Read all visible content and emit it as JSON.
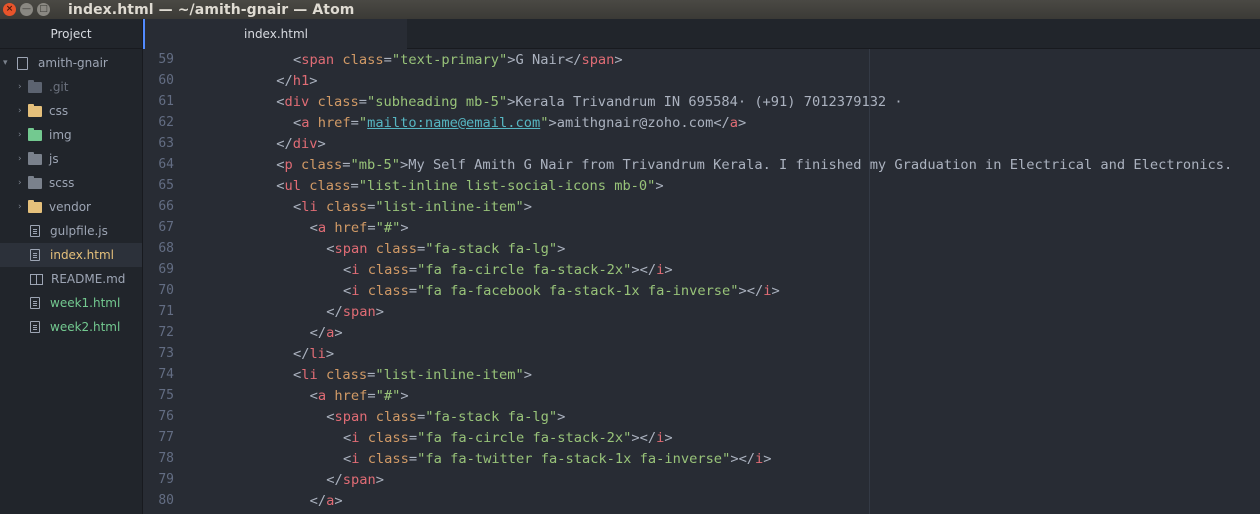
{
  "window": {
    "title": "index.html — ~/amith-gnair — Atom",
    "close_glyph": "×",
    "minimize_glyph": "—",
    "maximize_glyph": "□"
  },
  "sidebar": {
    "header": "Project",
    "root": {
      "name": "amith-gnair",
      "icon": "repo-icon"
    },
    "items": [
      {
        "name": ".git",
        "kind": "folder",
        "icon": "folder-icon",
        "color": "#5c6370"
      },
      {
        "name": "css",
        "kind": "folder",
        "icon": "folder-icon",
        "color": "#e5c07b"
      },
      {
        "name": "img",
        "kind": "folder",
        "icon": "folder-icon",
        "color": "#73c990"
      },
      {
        "name": "js",
        "kind": "folder",
        "icon": "folder-icon",
        "color": "#7a818c"
      },
      {
        "name": "scss",
        "kind": "folder",
        "icon": "folder-icon",
        "color": "#7a818c"
      },
      {
        "name": "vendor",
        "kind": "folder",
        "icon": "folder-icon",
        "color": "#e5c07b"
      },
      {
        "name": "gulpfile.js",
        "kind": "file",
        "icon": "file-icon"
      },
      {
        "name": "index.html",
        "kind": "file",
        "icon": "file-icon",
        "selected": true
      },
      {
        "name": "README.md",
        "kind": "file",
        "icon": "book-icon"
      },
      {
        "name": "week1.html",
        "kind": "file",
        "icon": "file-icon"
      },
      {
        "name": "week2.html",
        "kind": "file",
        "icon": "file-icon"
      }
    ]
  },
  "tabs": [
    {
      "label": "index.html",
      "active": true
    }
  ],
  "editor": {
    "colors": {
      "tag": "#e06c75",
      "attr": "#d19a66",
      "string": "#98c379",
      "text": "#abb2bf",
      "gutter": "#636d83"
    },
    "lines": [
      {
        "num": "59",
        "indent": 6,
        "code": "<span class=\"text-primary\">G Nair</span>"
      },
      {
        "num": "60",
        "indent": 5,
        "code": "</h1>"
      },
      {
        "num": "61",
        "indent": 5,
        "code": "<div class=\"subheading mb-5\">Kerala Trivandrum IN 695584· (+91) 7012379132 ·"
      },
      {
        "num": "62",
        "indent": 6,
        "code": "<a href=\"mailto:name@email.com\">amithgnair@zoho.com</a>"
      },
      {
        "num": "63",
        "indent": 5,
        "code": "</div>"
      },
      {
        "num": "64",
        "indent": 5,
        "code": "<p class=\"mb-5\">My Self Amith G Nair from Trivandrum Kerala. I finished my Graduation in Electrical and Electronics."
      },
      {
        "num": "65",
        "indent": 5,
        "code": "<ul class=\"list-inline list-social-icons mb-0\">"
      },
      {
        "num": "66",
        "indent": 6,
        "code": "<li class=\"list-inline-item\">"
      },
      {
        "num": "67",
        "indent": 7,
        "code": "<a href=\"#\">"
      },
      {
        "num": "68",
        "indent": 8,
        "code": "<span class=\"fa-stack fa-lg\">"
      },
      {
        "num": "69",
        "indent": 9,
        "code": "<i class=\"fa fa-circle fa-stack-2x\"></i>"
      },
      {
        "num": "70",
        "indent": 9,
        "code": "<i class=\"fa fa-facebook fa-stack-1x fa-inverse\"></i>"
      },
      {
        "num": "71",
        "indent": 8,
        "code": "</span>"
      },
      {
        "num": "72",
        "indent": 7,
        "code": "</a>"
      },
      {
        "num": "73",
        "indent": 6,
        "code": "</li>"
      },
      {
        "num": "74",
        "indent": 6,
        "code": "<li class=\"list-inline-item\">"
      },
      {
        "num": "75",
        "indent": 7,
        "code": "<a href=\"#\">"
      },
      {
        "num": "76",
        "indent": 8,
        "code": "<span class=\"fa-stack fa-lg\">"
      },
      {
        "num": "77",
        "indent": 9,
        "code": "<i class=\"fa fa-circle fa-stack-2x\"></i>"
      },
      {
        "num": "78",
        "indent": 9,
        "code": "<i class=\"fa fa-twitter fa-stack-1x fa-inverse\"></i>"
      },
      {
        "num": "79",
        "indent": 8,
        "code": "</span>"
      },
      {
        "num": "80",
        "indent": 7,
        "code": "</a>"
      }
    ]
  }
}
